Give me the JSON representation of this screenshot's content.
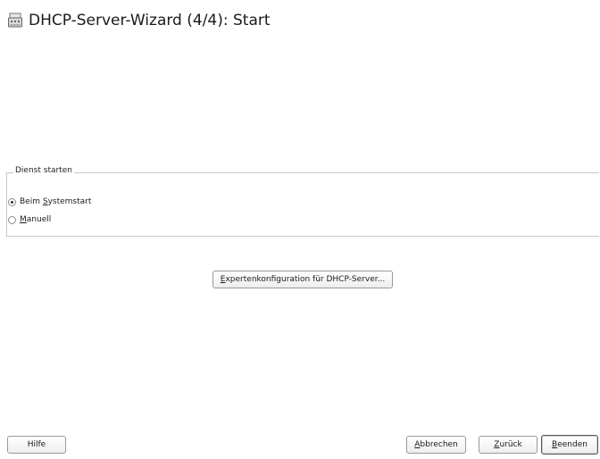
{
  "window": {
    "title": "DHCP-Server-Wizard (4/4): Start",
    "icon": "server-icon"
  },
  "service_start": {
    "legend": "Dienst starten",
    "options": [
      {
        "pre": "Beim ",
        "mnemonic": "S",
        "post": "ystemstart",
        "checked": true
      },
      {
        "pre": "",
        "mnemonic": "M",
        "post": "anuell",
        "checked": false
      }
    ]
  },
  "expert_button": {
    "mnemonic": "E",
    "post": "xpertenkonfiguration für DHCP-Server..."
  },
  "footer": {
    "help": "Hilfe",
    "abort": {
      "mnemonic": "A",
      "post": "bbrechen"
    },
    "back": {
      "mnemonic": "Z",
      "post": "urück"
    },
    "finish": {
      "mnemonic": "B",
      "post": "eenden"
    }
  }
}
